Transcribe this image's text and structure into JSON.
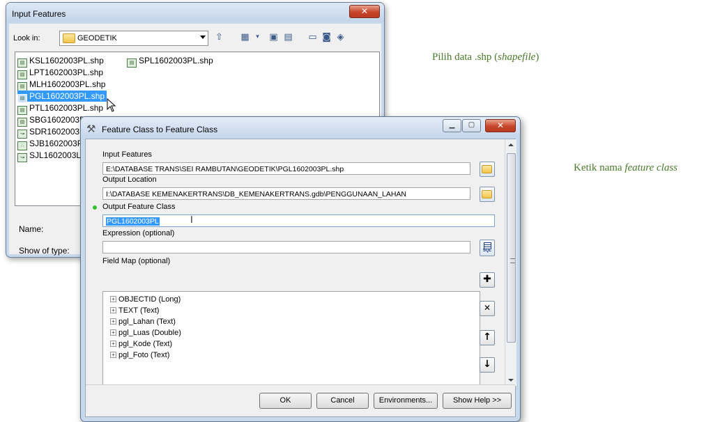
{
  "input_dialog": {
    "title": "Input Features",
    "look_in_label": "Look in:",
    "look_in_value": "GEODETIK",
    "name_label": "Name:",
    "type_label": "Show of type:",
    "files": [
      {
        "name": "KSL1602003PL.shp"
      },
      {
        "name": "SPL1602003PL.shp"
      },
      {
        "name": "LPT1602003PL.shp"
      },
      {
        "name": "MLH1602003PL.shp"
      },
      {
        "name": "PGL1602003PL.shp",
        "selected": true
      },
      {
        "name": "PTL1602003PL.shp"
      },
      {
        "name": "SBG1602003P"
      },
      {
        "name": "SDR1602003L"
      },
      {
        "name": "SJB1602003P"
      },
      {
        "name": "SJL1602003LI"
      }
    ]
  },
  "fc_dialog": {
    "title": "Feature Class to Feature Class",
    "input_features_label": "Input Features",
    "input_features_value": "E:\\DATABASE TRANS\\SEI RAMBUTAN\\GEODETIK\\PGL1602003PL.shp",
    "output_location_label": "Output Location",
    "output_location_value": "I:\\DATABASE KEMENAKERTRANS\\DB_KEMENAKERTRANS.gdb\\PENGGUNAAN_LAHAN",
    "output_fc_label": "Output Feature Class",
    "output_fc_value": "PGL1602003PL",
    "expression_label": "Expression (optional)",
    "expression_value": "",
    "field_map_label": "Field Map (optional)",
    "fields": [
      "OBJECTID (Long)",
      "TEXT (Text)",
      "pgl_Lahan (Text)",
      "pgl_Luas (Double)",
      "pgl_Kode (Text)",
      "pgl_Foto (Text)"
    ],
    "buttons": {
      "ok": "OK",
      "cancel": "Cancel",
      "environments": "Environments...",
      "show_help": "Show Help >>"
    },
    "sql_label": "SQL"
  },
  "captions": {
    "pick_prefix": "Pilih data .shp (",
    "pick_em": "shapefile",
    "pick_suffix": ")",
    "type_prefix": "Ketik nama ",
    "type_em": "feature class"
  },
  "colors": {
    "caption": "#4a7a2a",
    "selection": "#3399ff",
    "required_dot": "#2fbf2f"
  }
}
